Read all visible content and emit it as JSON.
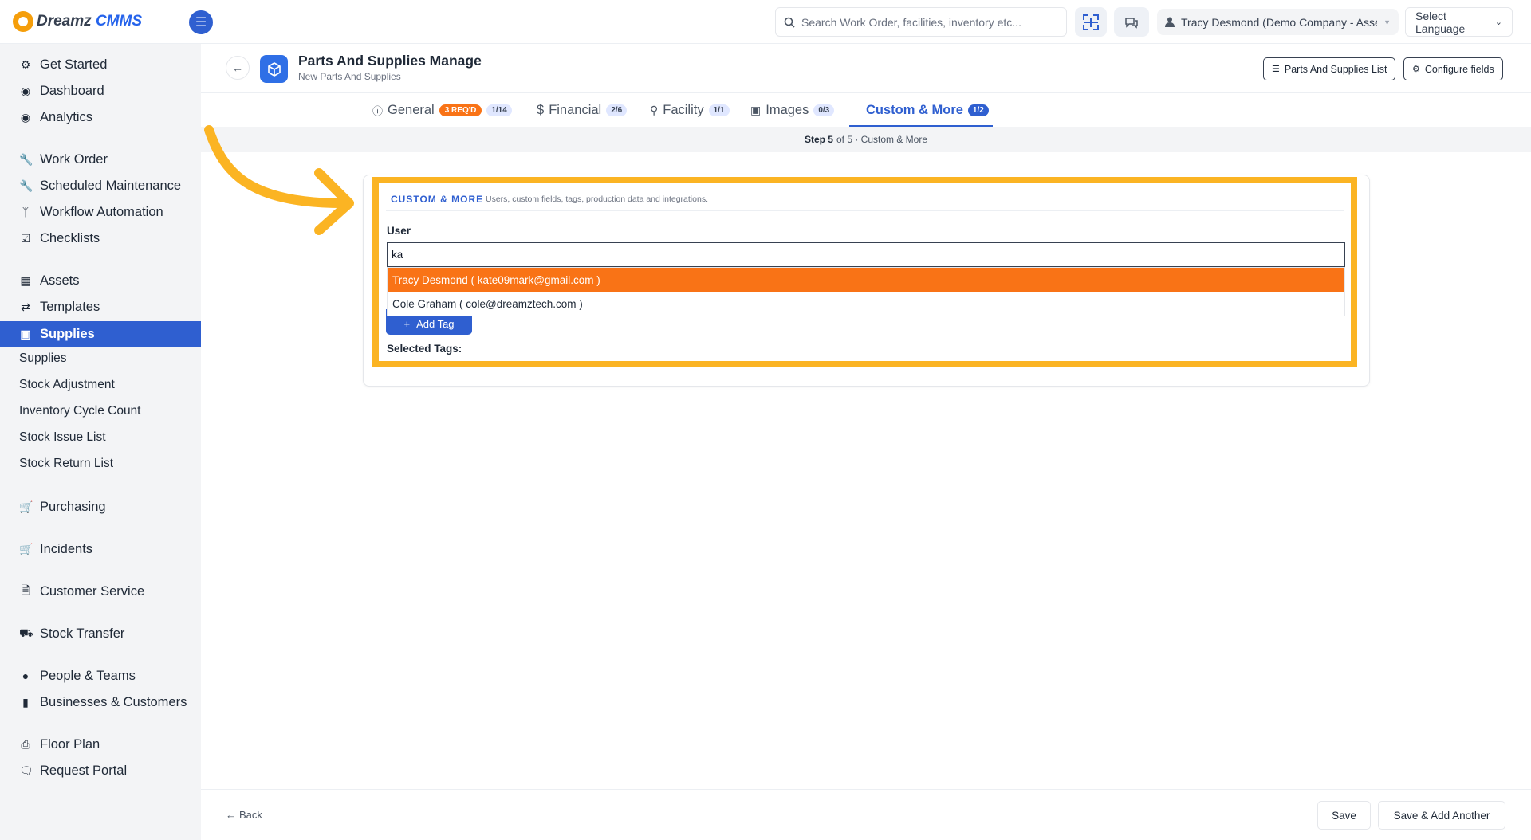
{
  "app": {
    "logo_brand": "Dreamz",
    "logo_product": "CMMS"
  },
  "topbar": {
    "search_placeholder": "Search Work Order, facilities, inventory etc...",
    "user_label": "Tracy Desmond (Demo Company - Asse...",
    "language_label": "Select Language"
  },
  "sidebar": {
    "items": [
      {
        "label": "Get Started",
        "icon": "gears-icon"
      },
      {
        "label": "Dashboard",
        "icon": "dashboard-icon"
      },
      {
        "label": "Analytics",
        "icon": "analytics-icon"
      },
      {
        "label": "Work Order",
        "icon": "wrench-icon"
      },
      {
        "label": "Scheduled Maintenance",
        "icon": "wrench-icon"
      },
      {
        "label": "Workflow Automation",
        "icon": "branch-icon"
      },
      {
        "label": "Checklists",
        "icon": "checkbox-icon"
      },
      {
        "label": "Assets",
        "icon": "archive-icon"
      },
      {
        "label": "Templates",
        "icon": "shuffle-icon"
      },
      {
        "label": "Supplies",
        "icon": "briefcase-icon",
        "active": true
      },
      {
        "label": "Purchasing",
        "icon": "cart-icon"
      },
      {
        "label": "Incidents",
        "icon": "cart-icon"
      },
      {
        "label": "Customer Service",
        "icon": "file-icon"
      },
      {
        "label": "Stock Transfer",
        "icon": "truck-icon"
      },
      {
        "label": "People & Teams",
        "icon": "users-icon"
      },
      {
        "label": "Businesses & Customers",
        "icon": "video-icon"
      },
      {
        "label": "Floor Plan",
        "icon": "print-icon"
      },
      {
        "label": "Request Portal",
        "icon": "chat-icon"
      }
    ],
    "sub_items": [
      "Supplies",
      "Stock Adjustment",
      "Inventory Cycle Count",
      "Stock Issue List",
      "Stock Return List"
    ]
  },
  "header": {
    "title": "Parts And Supplies Manage",
    "subtitle": "New Parts And Supplies",
    "list_button": "Parts And Supplies List",
    "configure_button": "Configure fields"
  },
  "tabs": [
    {
      "label": "General",
      "required": "3 REQ'D",
      "count": "1/14"
    },
    {
      "label": "Financial",
      "count": "2/6"
    },
    {
      "label": "Facility",
      "count": "1/1"
    },
    {
      "label": "Images",
      "count": "0/3"
    },
    {
      "label": "Custom & More",
      "count": "1/2",
      "active": true
    }
  ],
  "step": {
    "current": "Step 5",
    "rest": "of 5 · Custom & More"
  },
  "section": {
    "title": "CUSTOM & MORE",
    "description": "Users, custom fields, tags, production data and integrations.",
    "user_label": "User",
    "user_value": "ka",
    "options": [
      "Tracy Desmond ( kate09mark@gmail.com )",
      "Cole Graham ( cole@dreamztech.com )"
    ],
    "add_tag_label": "Add Tag",
    "selected_tags_label": "Selected Tags:"
  },
  "footer": {
    "back_label": "Back",
    "save_label": "Save",
    "save_add_label": "Save & Add Another"
  },
  "colors": {
    "primary": "#2f5fd0",
    "highlight": "#fbb423",
    "option_highlight": "#f97316"
  }
}
